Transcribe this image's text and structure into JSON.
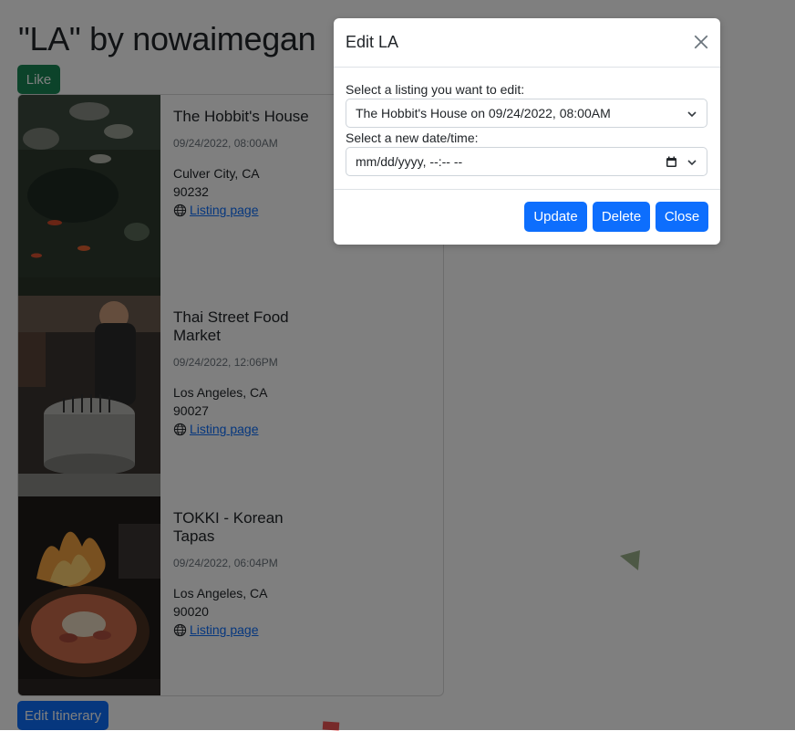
{
  "page": {
    "title": "\"LA\" by nowaimegan",
    "like_label": "Like",
    "edit_label": "Edit Itinerary"
  },
  "listings": [
    {
      "name": "The Hobbit's House",
      "time": "09/24/2022, 08:00AM",
      "city": "Culver City, CA",
      "zip": "90232",
      "link": "Listing page"
    },
    {
      "name": "Thai Street Food Market",
      "time": "09/24/2022, 12:06PM",
      "city": "Los Angeles, CA",
      "zip": "90027",
      "link": "Listing page"
    },
    {
      "name": "TOKKI - Korean Tapas",
      "time": "09/24/2022, 06:04PM",
      "city": "Los Angeles, CA",
      "zip": "90020",
      "link": "Listing page"
    }
  ],
  "modal": {
    "title": "Edit LA",
    "listing_label": "Select a listing you want to edit:",
    "listing_value": "The Hobbit's House on 09/24/2022, 08:00AM",
    "datetime_label": "Select a new date/time:",
    "datetime_placeholder": "mm/dd/yyyy, --:-- --",
    "update_label": "Update",
    "delete_label": "Delete",
    "close_label": "Close"
  },
  "icons": {
    "globe": "globe-icon",
    "close": "close-icon",
    "chevron": "chevron-down-icon",
    "calendar": "calendar-icon"
  },
  "colors": {
    "primary": "#0d6efd",
    "success": "#198754",
    "backdrop": "rgba(0,0,0,0.5)"
  }
}
